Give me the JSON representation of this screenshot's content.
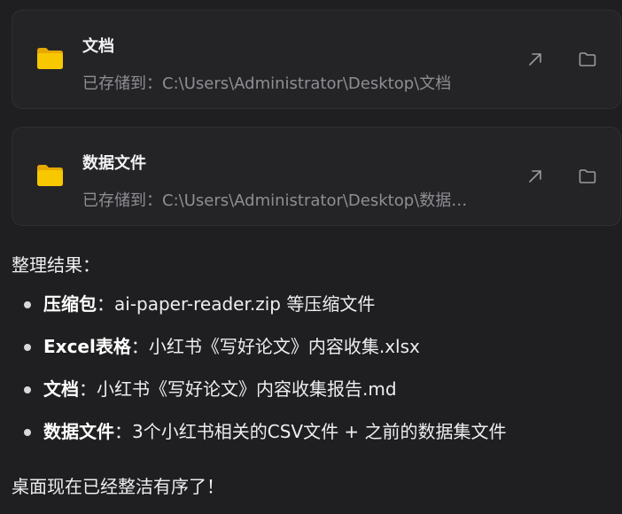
{
  "cards": [
    {
      "title": "文档",
      "path": "已存储到：C:\\Users\\Administrator\\Desktop\\文档",
      "icon": "folder-icon",
      "actions": [
        "open-external-icon",
        "folder-outline-icon"
      ]
    },
    {
      "title": "数据文件",
      "path": "已存储到：C:\\Users\\Administrator\\Desktop\\数据…",
      "icon": "folder-icon",
      "actions": [
        "open-external-icon",
        "folder-outline-icon"
      ]
    }
  ],
  "summary": {
    "title": "整理结果：",
    "items": [
      {
        "label": "压缩包",
        "sep": "：",
        "text": "ai-paper-reader.zip 等压缩文件"
      },
      {
        "label": "Excel表格",
        "sep": "：",
        "text": "小红书《写好论文》内容收集.xlsx"
      },
      {
        "label": "文档",
        "sep": "：",
        "text": "小红书《写好论文》内容收集报告.md"
      },
      {
        "label": "数据文件",
        "sep": "：",
        "text": "3个小红书相关的CSV文件 + 之前的数据集文件"
      }
    ],
    "closing": "桌面现在已经整洁有序了！"
  },
  "colors": {
    "background": "#1f1f21",
    "card": "#242427",
    "folder": "#f4c20d",
    "muted_text": "#8e8e93"
  }
}
